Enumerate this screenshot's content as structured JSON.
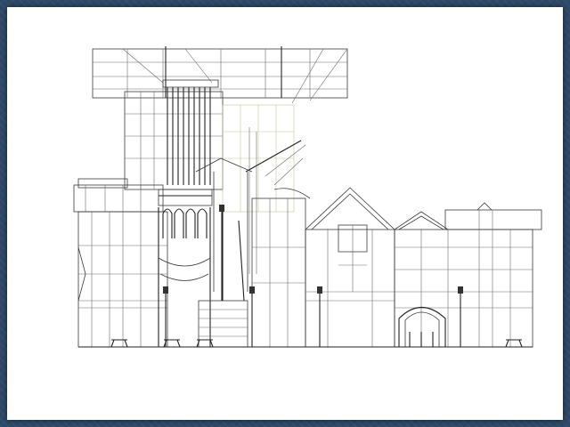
{
  "viewer": {
    "background_color": "#2e4a6a",
    "canvas_color": "#ffffff",
    "line_color": "#3a3a3a"
  },
  "drawing": {
    "subject": "building-elevation-wireframe",
    "icons": [
      "lamp-post-icon",
      "bench-icon",
      "arch-gateway-icon"
    ]
  }
}
